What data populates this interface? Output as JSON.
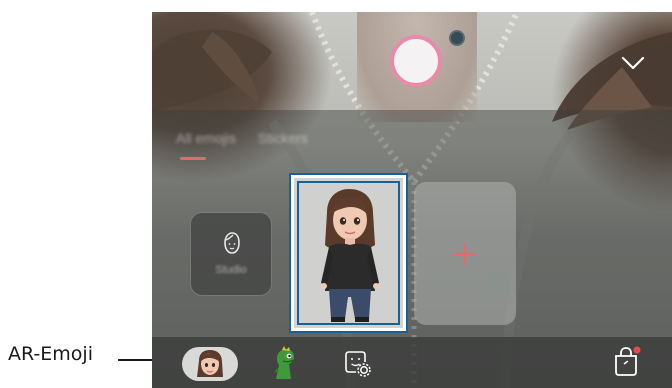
{
  "callout": {
    "label": "AR-Emoji"
  },
  "tabs": [
    {
      "label": "All emojis",
      "active": true
    },
    {
      "label": "Stickers",
      "active": false
    }
  ],
  "tiles": {
    "studio_label": "Studio"
  },
  "icons": {
    "shutter": "shutter-button",
    "collapse": "chevron-down-icon",
    "studio": "face-outline-icon",
    "add": "plus-icon",
    "ar_emoji": "avatar-icon",
    "dino": "dinosaur-emoji-icon",
    "sticker_settings": "sticker-settings-icon",
    "store": "shopping-bag-icon"
  },
  "colors": {
    "accent": "#e36a6a",
    "selection_border": "#1b5f97",
    "shutter_ring": "#e88aa8"
  }
}
